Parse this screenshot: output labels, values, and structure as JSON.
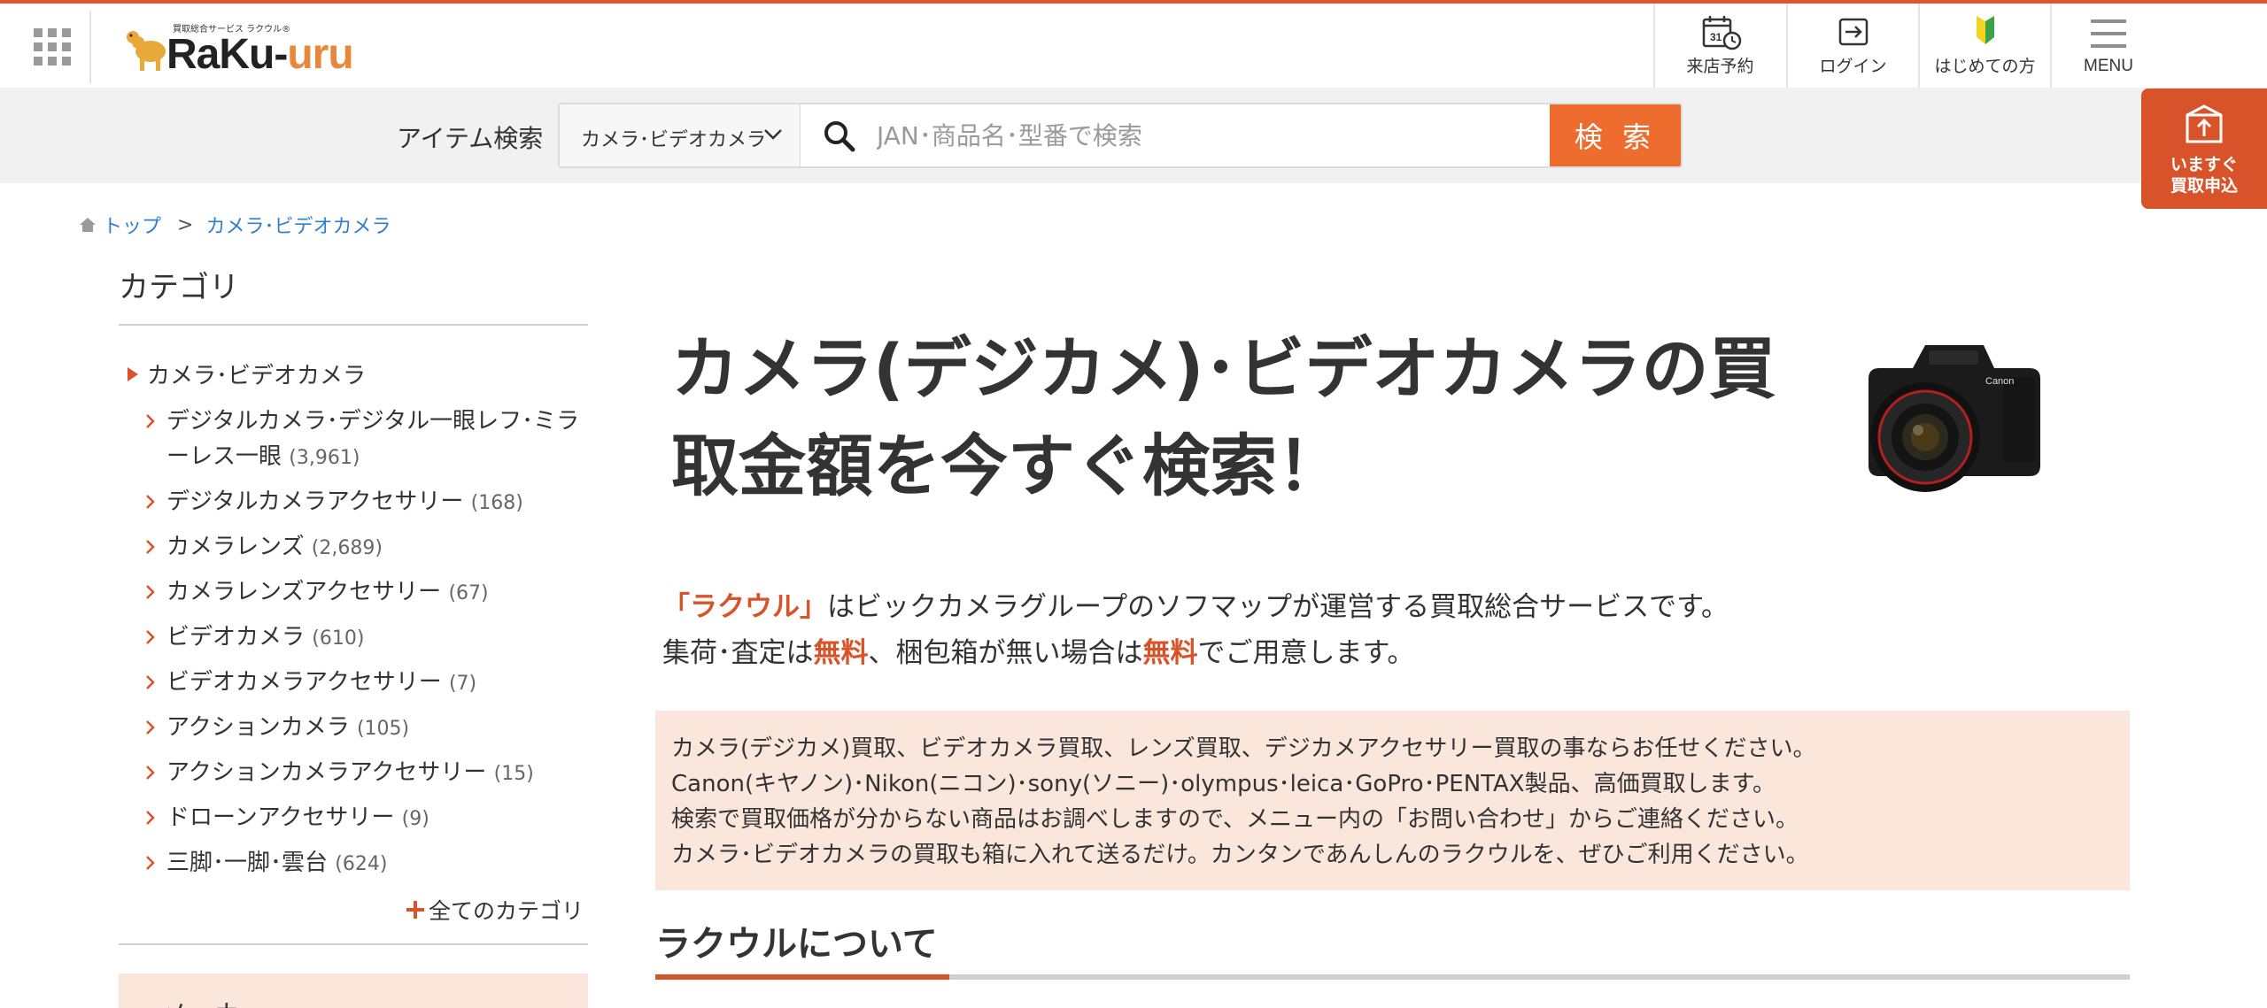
{
  "colors": {
    "accent": "#d9532a",
    "search_button": "#ef6c2f",
    "link": "#2f7fd0",
    "notice_bg": "#fbe6dc",
    "search_band_bg": "#f1f1f1"
  },
  "header": {
    "logo_tagline": "買取総合サービス ラクウル®",
    "logo_text_main": "RaKu-",
    "logo_text_accent": "uru",
    "nav": [
      {
        "label": "来店予約",
        "icon": "calendar-clock-icon"
      },
      {
        "label": "ログイン",
        "icon": "login-icon"
      },
      {
        "label": "はじめての方",
        "icon": "beginner-leaf-icon"
      },
      {
        "label": "MENU",
        "icon": "hamburger-menu-icon"
      }
    ]
  },
  "search": {
    "label": "アイテム検索",
    "category_selected": "カメラ･ビデオカメラ",
    "placeholder": "JAN･商品名･型番で検索",
    "button_label": "検 索"
  },
  "cta": {
    "label": "いますぐ\n買取申込",
    "icon": "box-upload-icon"
  },
  "breadcrumb": {
    "home": "トップ",
    "separator": ">",
    "current": "カメラ･ビデオカメラ"
  },
  "sidebar": {
    "title": "カテゴリ",
    "parent": "カメラ･ビデオカメラ",
    "items": [
      {
        "label": "デジタルカメラ･デジタル一眼レフ･ミラーレス一眼",
        "count": "(3,961)"
      },
      {
        "label": "デジタルカメラアクセサリー",
        "count": "(168)"
      },
      {
        "label": "カメラレンズ",
        "count": "(2,689)"
      },
      {
        "label": "カメラレンズアクセサリー",
        "count": "(67)"
      },
      {
        "label": "ビデオカメラ",
        "count": "(610)"
      },
      {
        "label": "ビデオカメラアクセサリー",
        "count": "(7)"
      },
      {
        "label": "アクションカメラ",
        "count": "(105)"
      },
      {
        "label": "アクションカメラアクセサリー",
        "count": "(15)"
      },
      {
        "label": "ドローンアクセサリー",
        "count": "(9)"
      },
      {
        "label": "三脚･一脚･雲台",
        "count": "(624)"
      }
    ],
    "all_categories": "全てのカテゴリ",
    "maker_heading": "メーカ"
  },
  "main": {
    "title": "カメラ(デジカメ)･ビデオカメラの買取金額を今すぐ検索！",
    "intro_brand": "「ラクウル」",
    "intro_line1_rest": "はビックカメラグループのソフマップが運営する買取総合サービスです。",
    "intro_line2_a": "集荷･査定は",
    "intro_free1": "無料",
    "intro_line2_b": "、梱包箱が無い場合は",
    "intro_free2": "無料",
    "intro_line2_c": "でご用意します。",
    "notice": [
      "カメラ(デジカメ)買取、ビデオカメラ買取、レンズ買取、デジカメアクセサリー買取の事ならお任せください。",
      "Canon(キヤノン)･Nikon(ニコン)･sony(ソニー)･olympus･leica･GoPro･PENTAX製品、高価買取します。",
      "検索で買取価格が分からない商品はお調べしますので、メニュー内の「お問い合わせ」からご連絡ください。",
      "カメラ･ビデオカメラの買取も箱に入れて送るだけ。カンタンであんしんのラクウルを、ぜひご利用ください。"
    ],
    "about_title": "ラクウルについて",
    "camera_image": "dslr-camera-with-lens"
  }
}
